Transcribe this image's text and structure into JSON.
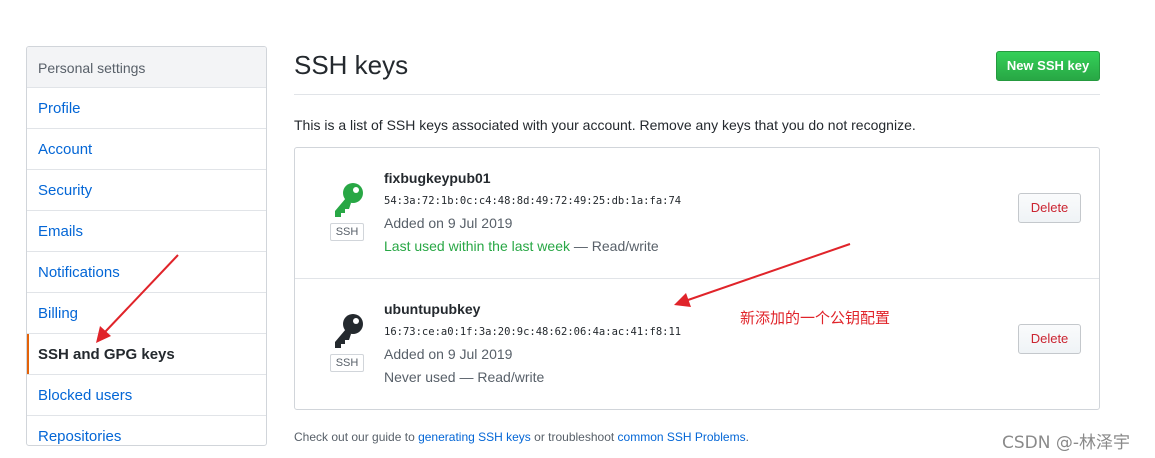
{
  "sidebar": {
    "header": "Personal settings",
    "items": [
      {
        "label": "Profile"
      },
      {
        "label": "Account"
      },
      {
        "label": "Security"
      },
      {
        "label": "Emails"
      },
      {
        "label": "Notifications"
      },
      {
        "label": "Billing"
      },
      {
        "label": "SSH and GPG keys",
        "selected": true
      },
      {
        "label": "Blocked users"
      },
      {
        "label": "Repositories"
      }
    ]
  },
  "main": {
    "title": "SSH keys",
    "new_key_label": "New SSH key",
    "intro": "This is a list of SSH keys associated with your account. Remove any keys that you do not recognize.",
    "keys": [
      {
        "name": "fixbugkeypub01",
        "fingerprint": "54:3a:72:1b:0c:c4:48:8d:49:72:49:25:db:1a:fa:74",
        "added": "Added on 9 Jul 2019",
        "last_used": "Last used within the last week",
        "access": " — Read/write",
        "badge": "SSH",
        "delete_label": "Delete",
        "icon": "key-icon",
        "icon_color": "#28a745"
      },
      {
        "name": "ubuntupubkey",
        "fingerprint": "16:73:ce:a0:1f:3a:20:9c:48:62:06:4a:ac:41:f8:11",
        "added": "Added on 9 Jul 2019",
        "last_used": "Never used",
        "access": " — Read/write",
        "badge": "SSH",
        "delete_label": "Delete",
        "icon": "key-icon",
        "icon_color": "#24292e"
      }
    ],
    "footer": {
      "prefix": "Check out our guide to ",
      "link1": "generating SSH keys",
      "middle": " or troubleshoot ",
      "link2": "common SSH Problems",
      "suffix": "."
    }
  },
  "annotation": {
    "text": "新添加的一个公钥配置",
    "color": "#e0242a"
  },
  "watermark": "CSDN @-林泽宇",
  "colors": {
    "link": "#0366d6",
    "primary_button": "#28a745",
    "danger": "#cb2431",
    "selected_indicator": "#e36209"
  }
}
